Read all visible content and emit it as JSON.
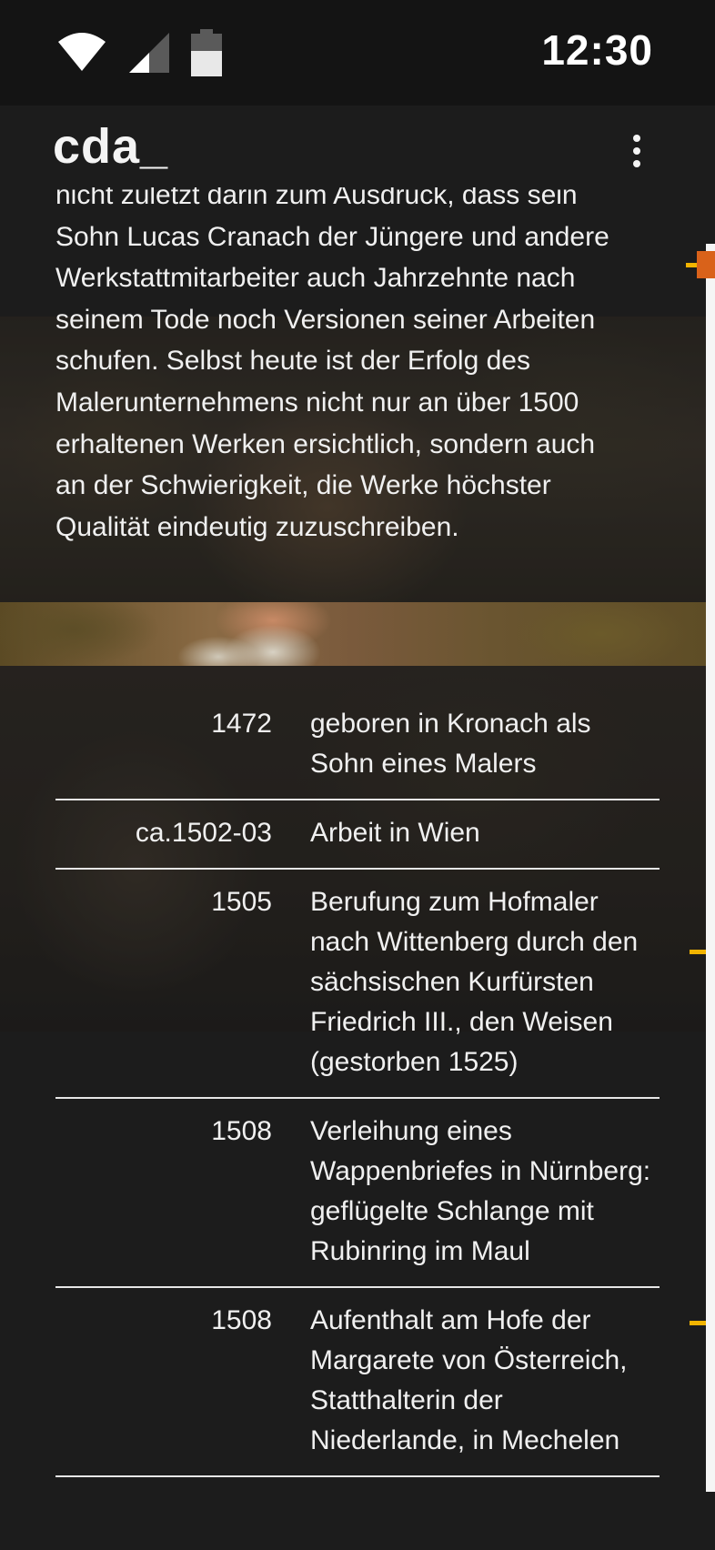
{
  "status_bar": {
    "time": "12:30"
  },
  "app_bar": {
    "logo": "cda_"
  },
  "intro": {
    "text": "nicht zuletzt darin zum Ausdruck, dass sein\nSohn Lucas Cranach der Jüngere und andere\nWerkstattmitarbeiter auch  Jahrzehnte nach\nseinem Tode noch Versionen seiner Arbeiten\nschufen.  Selbst heute ist der Erfolg des\nMalerunternehmens nicht nur an über 1500\nerhaltenen Werken ersichtlich, sondern auch\nan der Schwierigkeit, die  Werke höchster\nQualität eindeutig zuzuschreiben."
  },
  "timeline": [
    {
      "year": "1472",
      "text": "geboren in Kronach als Sohn eines Malers"
    },
    {
      "year": "ca.1502-03",
      "text": "Arbeit in Wien"
    },
    {
      "year": "1505",
      "text": "Berufung zum Hofmaler nach Wittenberg durch den sächsischen Kurfürsten Friedrich III., den Weisen (gestorben 1525)"
    },
    {
      "year": "1508",
      "text": "Verleihung eines Wappenbriefes in Nürnberg: geflügelte Schlange mit Rubinring im Maul"
    },
    {
      "year": "1508",
      "text": "Aufenthalt am Hofe der Margarete von Österreich, Statthalterin der Niederlande, in Mechelen"
    }
  ],
  "colors": {
    "scroll_thumb": "#d9621a",
    "scroll_marker": "#f2b400"
  },
  "icons": [
    "wifi-icon",
    "cellular-signal-icon",
    "battery-icon",
    "more-vert-icon"
  ]
}
